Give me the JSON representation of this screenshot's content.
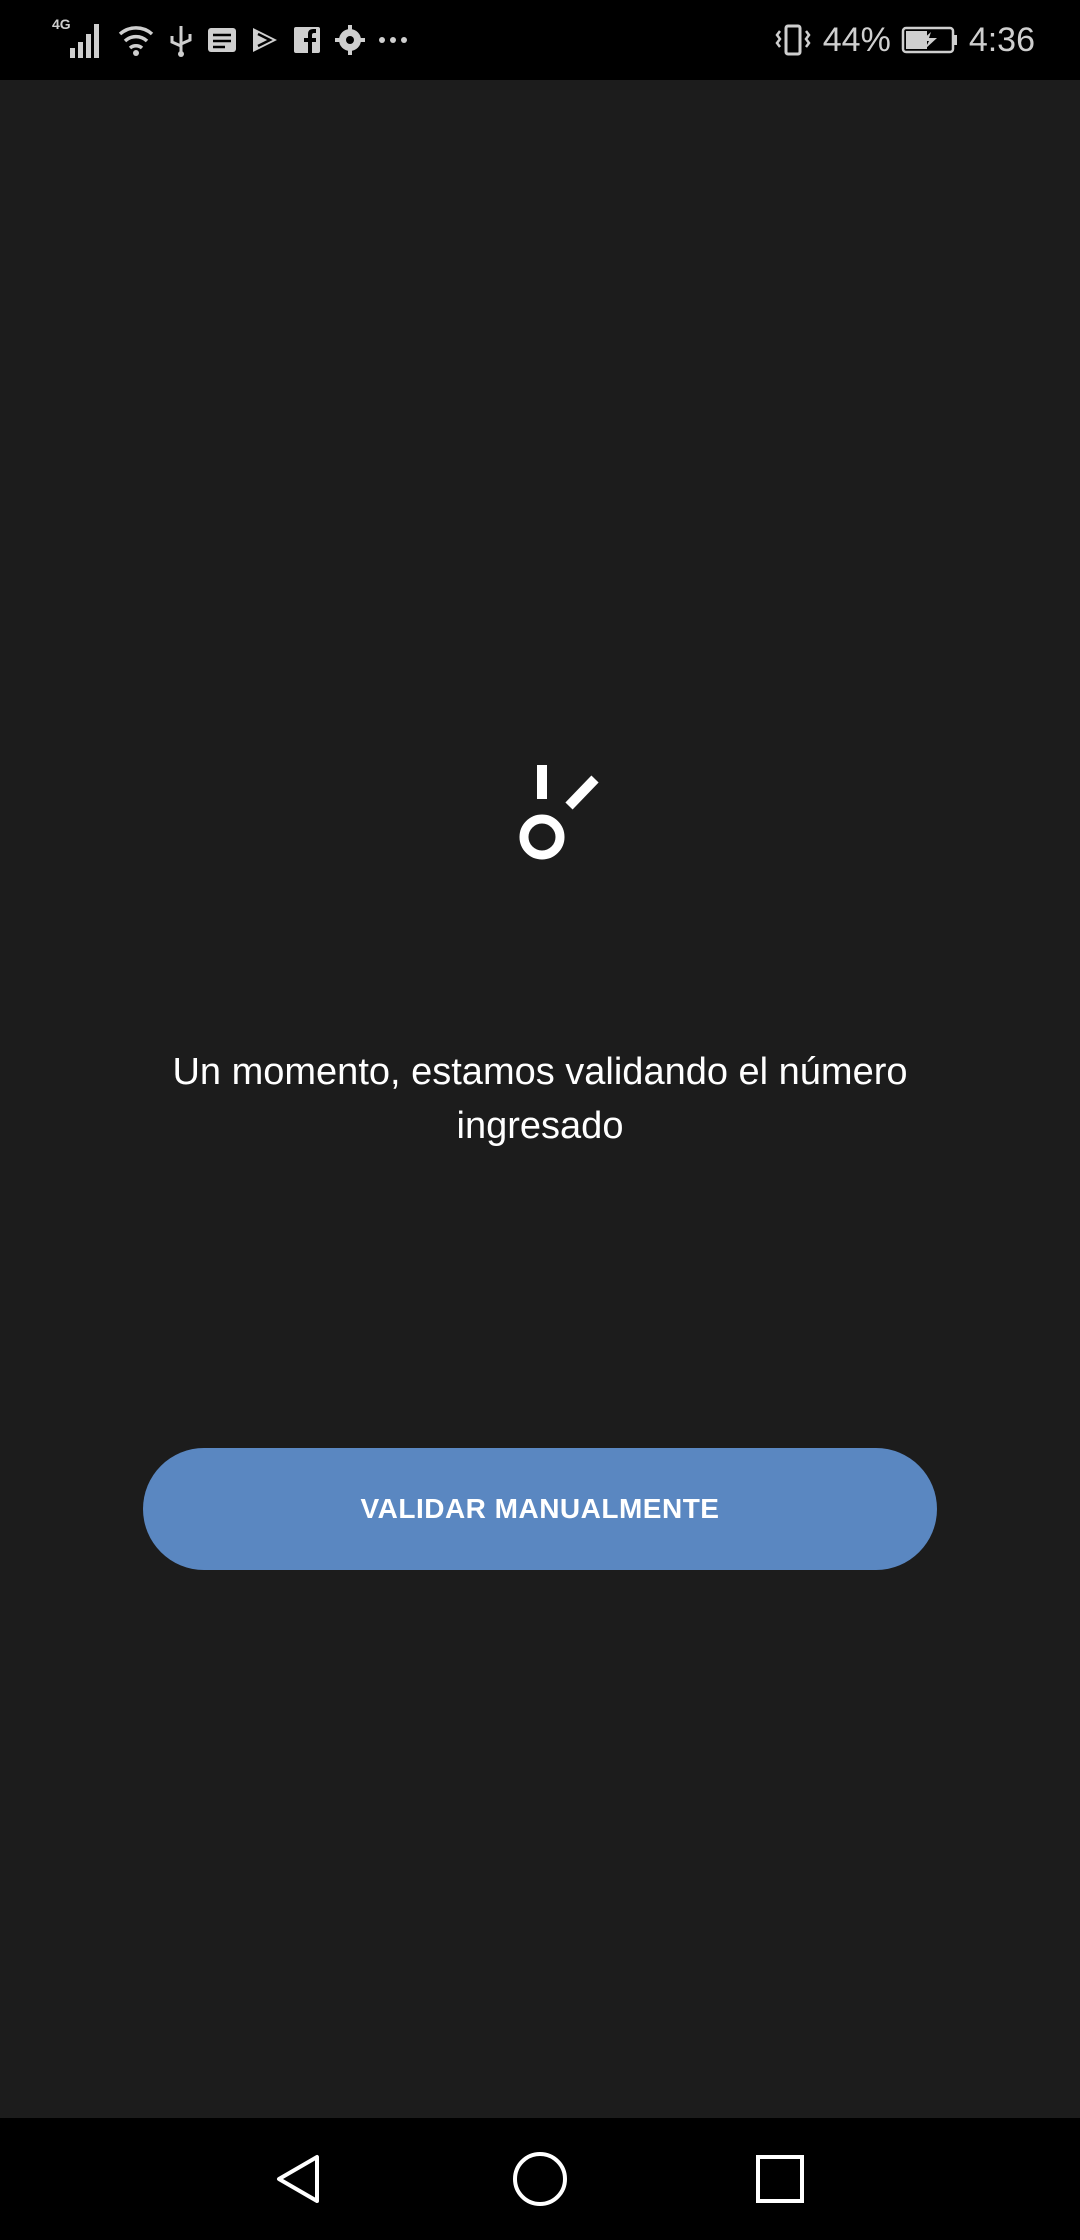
{
  "status_bar": {
    "network_label": "4G",
    "battery_percent": "44%",
    "time": "4:36",
    "left_icons": [
      "signal-icon",
      "wifi-icon",
      "usb-icon",
      "message-icon",
      "play-store-icon",
      "facebook-icon",
      "settings-icon",
      "more-icon"
    ],
    "right_icons": [
      "vibrate-icon",
      "battery-charging-icon"
    ]
  },
  "main": {
    "message": "Un momento, estamos validando el número ingresado",
    "validate_button_label": "VALIDAR MANUALMENTE"
  },
  "nav_bar": {
    "icons": [
      "back-icon",
      "home-icon",
      "recents-icon"
    ]
  },
  "colors": {
    "background": "#1c1c1c",
    "button": "#5a87c1",
    "text": "#ffffff"
  }
}
